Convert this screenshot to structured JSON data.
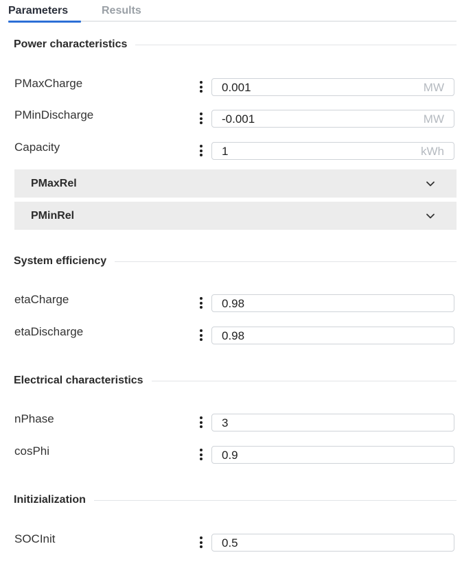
{
  "tabs": {
    "active": "Parameters",
    "inactive": "Results"
  },
  "sections": {
    "power": {
      "title": "Power characteristics",
      "rows": [
        {
          "label": "PMaxCharge",
          "value": "0.001",
          "unit": "MW"
        },
        {
          "label": "PMinDischarge",
          "value": "-0.001",
          "unit": "MW"
        },
        {
          "label": "Capacity",
          "value": "1",
          "unit": "kWh"
        }
      ],
      "collapsibles": [
        "PMaxRel",
        "PMinRel"
      ]
    },
    "efficiency": {
      "title": "System efficiency",
      "rows": [
        {
          "label": "etaCharge",
          "value": "0.98"
        },
        {
          "label": "etaDischarge",
          "value": "0.98"
        }
      ]
    },
    "electrical": {
      "title": "Electrical characteristics",
      "rows": [
        {
          "label": "nPhase",
          "value": "3"
        },
        {
          "label": "cosPhi",
          "value": "0.9"
        }
      ]
    },
    "init": {
      "title": "Initizialization",
      "rows": [
        {
          "label": "SOCInit",
          "value": "0.5"
        }
      ]
    }
  },
  "icons": {
    "options": "kebab-menu-icon",
    "expand": "chevron-down-icon"
  },
  "colors": {
    "accent": "#2c6fd6",
    "collapse_bg": "#ececec",
    "unit_text": "#b5bac0"
  }
}
